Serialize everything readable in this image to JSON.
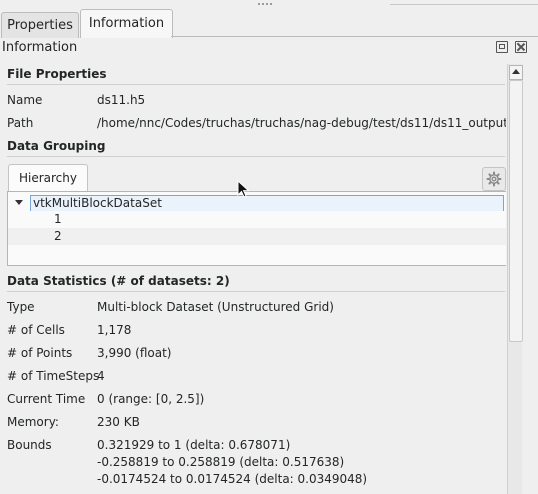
{
  "tabs": [
    {
      "label": "Properties"
    },
    {
      "label": "Information"
    }
  ],
  "panel": {
    "title": "Information"
  },
  "file_properties": {
    "heading": "File Properties",
    "name_label": "Name",
    "name_value": "ds11.h5",
    "path_label": "Path",
    "path_value": "/home/nnc/Codes/truchas/truchas/nag-debug/test/ds11/ds11_output"
  },
  "data_grouping": {
    "heading": "Data Grouping",
    "tab_label": "Hierarchy",
    "tree": {
      "root": "vtkMultiBlockDataSet",
      "children": [
        "1",
        "2"
      ]
    }
  },
  "data_statistics": {
    "heading": "Data Statistics (# of datasets: 2)",
    "rows": [
      {
        "label": "Type",
        "value": "Multi-block Dataset (Unstructured Grid)"
      },
      {
        "label": "# of Cells",
        "value": "1,178"
      },
      {
        "label": "# of Points",
        "value": "3,990 (float)"
      },
      {
        "label": "# of TimeSteps",
        "value": "4"
      },
      {
        "label": "Current Time",
        "value": "0 (range: [0, 2.5])"
      },
      {
        "label": "Memory:",
        "value": "230 KB"
      }
    ],
    "bounds_label": "Bounds",
    "bounds": [
      "0.321929 to 1 (delta: 0.678071)",
      "-0.258819 to 0.258819 (delta: 0.517638)",
      "-0.0174524 to 0.0174524 (delta: 0.0349048)"
    ]
  },
  "colors": {
    "selection_border": "#7aa6d6",
    "background": "#efefef"
  }
}
